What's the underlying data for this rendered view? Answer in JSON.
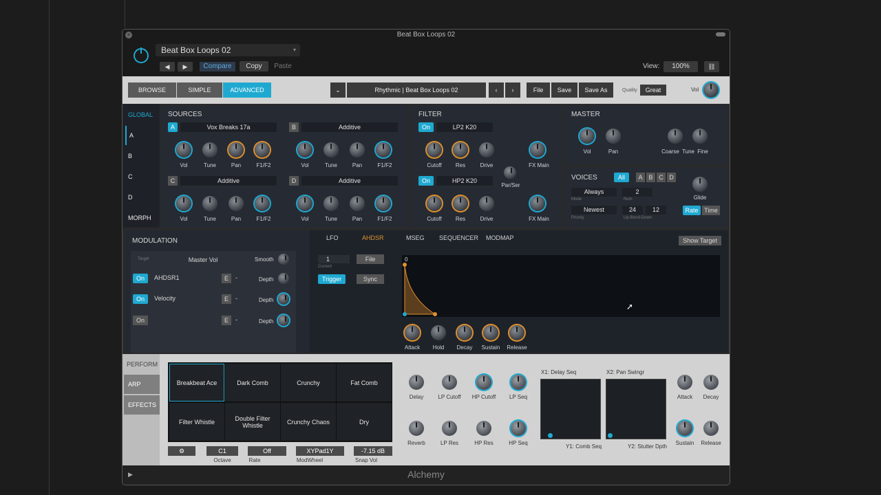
{
  "window": {
    "title": "Beat Box Loops 02",
    "footer_title": "Alchemy"
  },
  "header": {
    "preset_name": "Beat Box Loops 02",
    "compare_label": "Compare",
    "copy_label": "Copy",
    "paste_label": "Paste",
    "view_label": "View:",
    "view_value": "100%"
  },
  "toolbar": {
    "modes": [
      "BROWSE",
      "SIMPLE",
      "ADVANCED"
    ],
    "preset_path": "Rhythmic | Beat Box Loops 02",
    "file_label": "File",
    "save_label": "Save",
    "saveas_label": "Save As",
    "quality_label": "Quality",
    "quality_value": "Great",
    "vol_label": "Vol"
  },
  "sidebar": {
    "items": [
      "GLOBAL",
      "A",
      "B",
      "C",
      "D",
      "MORPH"
    ]
  },
  "sources": {
    "title": "SOURCES",
    "a": {
      "letter": "A",
      "name": "Vox Breaks 17a"
    },
    "b": {
      "letter": "B",
      "name": "Additive"
    },
    "c": {
      "letter": "C",
      "name": "Additive"
    },
    "d": {
      "letter": "D",
      "name": "Additive"
    },
    "knob_labels": [
      "Vol",
      "Tune",
      "Pan"
    ],
    "filter_select": "F1/F2"
  },
  "filter": {
    "title": "FILTER",
    "on": "On",
    "f1": "LP2 K20",
    "f2": "HP2 K20",
    "knobs": [
      "Cutoff",
      "Res",
      "Drive"
    ],
    "fx": "FX Main",
    "parser": "Par/Ser"
  },
  "master": {
    "title": "MASTER",
    "knobs": [
      "Vol",
      "Pan",
      "Coarse",
      "Tune",
      "Fine"
    ]
  },
  "voices": {
    "title": "VOICES",
    "all": "All",
    "letters": [
      "A",
      "B",
      "C",
      "D"
    ],
    "mode_value": "Always",
    "mode_label": "Mode",
    "num_value": "2",
    "num_label": "Num",
    "priority_value": "Newest",
    "priority_label": "Priority",
    "bend_up": "24",
    "bend_down": "12",
    "bend_label": "Up-Bend-Down",
    "glide": "Glide",
    "rate": "Rate",
    "time": "Time"
  },
  "modulation": {
    "title": "MODULATION",
    "target_label": "Target",
    "target_value": "Master Vol",
    "smooth": "Smooth",
    "rows": [
      {
        "on": "On",
        "source": "AHDSR1",
        "e": "E",
        "dash": "-",
        "depth": "Depth"
      },
      {
        "on": "On",
        "source": "Velocity",
        "e": "E",
        "dash": "-",
        "depth": "Depth"
      },
      {
        "on": "On",
        "source": "",
        "e": "E",
        "dash": "-",
        "depth": "Depth"
      }
    ]
  },
  "mod_tabs": [
    "LFO",
    "AHDSR",
    "MSEG",
    "SEQUENCER",
    "MODMAP"
  ],
  "ahdsr": {
    "current_value": "1",
    "current_label": "Current",
    "file": "File",
    "trigger": "Trigger",
    "sync": "Sync",
    "show_target": "Show Target",
    "graph_label": "0",
    "knobs": [
      "Attack",
      "Hold",
      "Decay",
      "Sustain",
      "Release"
    ]
  },
  "perform": {
    "tabs": [
      "PERFORM",
      "ARP",
      "EFFECTS"
    ],
    "pads": [
      "Breakbeat Ace",
      "Dark Comb",
      "Crunchy",
      "Fat Comb",
      "Filter Whistle",
      "Double Filter Whistle",
      "Crunchy Chaos",
      "Dry"
    ],
    "octave_value": "C1",
    "octave_label": "Octave",
    "rate_value": "Off",
    "rate_label": "Rate",
    "modwheel_value": "XYPad1Y",
    "modwheel_label": "ModWheel",
    "snapvol_value": "-7.15 dB",
    "snapvol_label": "Snap Vol",
    "knobs_top": [
      "Delay",
      "LP Cutoff",
      "HP Cutoff",
      "LP Seq"
    ],
    "knobs_bottom": [
      "Reverb",
      "LP Res",
      "HP Res",
      "HP Seq"
    ],
    "xy1_top": "X1: Delay Seq",
    "xy1_bottom": "Y1: Comb Seq",
    "xy2_top": "X2: Pan Swingr",
    "xy2_bottom": "Y2: Stutter Dpth",
    "right_knobs": [
      "Attack",
      "Decay",
      "Sustain",
      "Release"
    ]
  },
  "colors": {
    "accent": "#1fa9d1",
    "orange": "#e0902d",
    "panel": "#262b33"
  }
}
